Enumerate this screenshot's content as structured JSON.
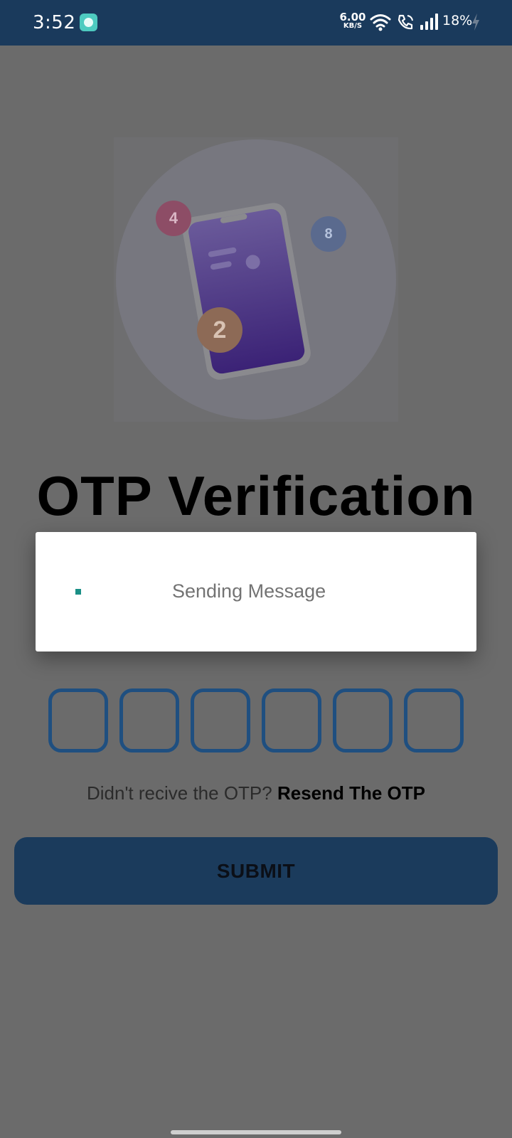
{
  "status_bar": {
    "time": "3:52",
    "app_icon": "ticket-app-icon",
    "speed_value": "6.00",
    "speed_unit": "KB/S",
    "battery": "18%"
  },
  "hero": {
    "badges": [
      "4",
      "8",
      "2"
    ],
    "badge_colors": [
      "#c8457a",
      "#5c7cc1",
      "#c98a5a"
    ]
  },
  "title": "OTP Verification",
  "otp": {
    "digits": [
      "",
      "",
      "",
      "",
      "",
      ""
    ]
  },
  "resend": {
    "prompt": "Didn't recive the OTP?",
    "link": "Resend The OTP"
  },
  "submit_label": "SUBMIT",
  "dialog": {
    "message": "Sending Message"
  },
  "colors": {
    "status_bar": "#1a3a5c",
    "accent": "#1f4f80",
    "spinner": "#1a8f86"
  }
}
